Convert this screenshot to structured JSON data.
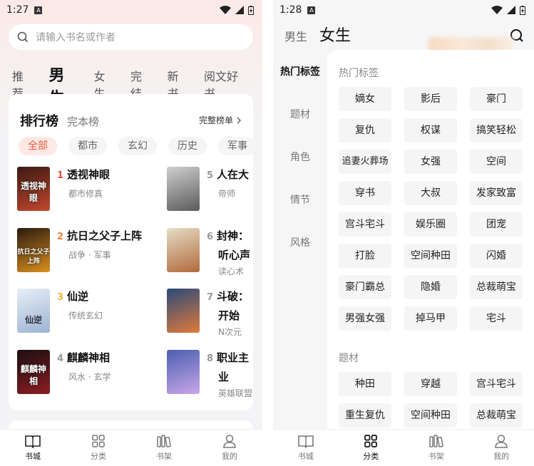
{
  "left": {
    "status": {
      "time": "1:27",
      "sim": "A"
    },
    "search": {
      "placeholder": "请输入书名或作者"
    },
    "topnav": [
      "推荐",
      "男生",
      "女生",
      "完结",
      "新书",
      "阅文好书"
    ],
    "rank": {
      "title": "排行榜",
      "subtitle": "完本榜",
      "more": "完整榜单"
    },
    "chips": [
      "全部",
      "都市",
      "玄幻",
      "历史",
      "军事"
    ],
    "books": [
      {
        "num": "1",
        "title": "透视神眼",
        "genre": "都市修真",
        "cover": "透视神眼",
        "c1": "#3a1a14",
        "c2": "#c4472d"
      },
      {
        "num": "2",
        "title": "抗日之父子上阵",
        "genre": "战争 · 军事",
        "cover": "抗日之父子上阵",
        "c1": "#2b1a0e",
        "c2": "#d9901f"
      },
      {
        "num": "3",
        "title": "仙逆",
        "genre": "传统玄幻",
        "cover": "仙逆",
        "c1": "#e8eef6",
        "c2": "#9bb3d4"
      },
      {
        "num": "4",
        "title": "麒麟神相",
        "genre": "风水 · 玄学",
        "cover": "麒麟神相",
        "c1": "#1a0f10",
        "c2": "#8c1d22"
      },
      {
        "num": "5",
        "title": "人在大",
        "genre": "帝师",
        "cover": "",
        "c1": "#cfcfcf",
        "c2": "#5a5a5a"
      },
      {
        "num": "6",
        "title": "封神：",
        "title2": "听心声",
        "genre": "读心术",
        "cover": "",
        "c1": "#e7dcc6",
        "c2": "#b06a3b"
      },
      {
        "num": "7",
        "title": "斗破：",
        "title2": "开始",
        "genre": "N次元",
        "cover": "",
        "c1": "#2a4a7a",
        "c2": "#e07a3a"
      },
      {
        "num": "8",
        "title": "职业主",
        "title2": "业",
        "genre": "英雄联盟",
        "cover": "",
        "c1": "#4b5fb0",
        "c2": "#c9a7e8"
      }
    ],
    "bottomnav": [
      "书城",
      "分类",
      "书架",
      "我的"
    ]
  },
  "right": {
    "status": {
      "time": "1:28",
      "sim": "A"
    },
    "tabs": [
      "男生",
      "女生"
    ],
    "sidecats": [
      "热门标签",
      "题材",
      "角色",
      "情节",
      "风格"
    ],
    "section1": "热门标签",
    "hot_tags": [
      "嫡女",
      "影后",
      "豪门",
      "复仇",
      "权谋",
      "搞笑轻松",
      "追妻火葬场",
      "女强",
      "空间",
      "穿书",
      "大叔",
      "发家致富",
      "宫斗宅斗",
      "娱乐圈",
      "团宠",
      "打脸",
      "空间种田",
      "闪婚",
      "豪门霸总",
      "隐婚",
      "总裁萌宝",
      "男强女强",
      "掉马甲",
      "宅斗"
    ],
    "section2": "题材",
    "theme_tags": [
      "种田",
      "穿越",
      "宫斗宅斗",
      "重生复仇",
      "空间种田",
      "总裁萌宝"
    ],
    "bottomnav": [
      "书城",
      "分类",
      "书架",
      "我的"
    ]
  }
}
